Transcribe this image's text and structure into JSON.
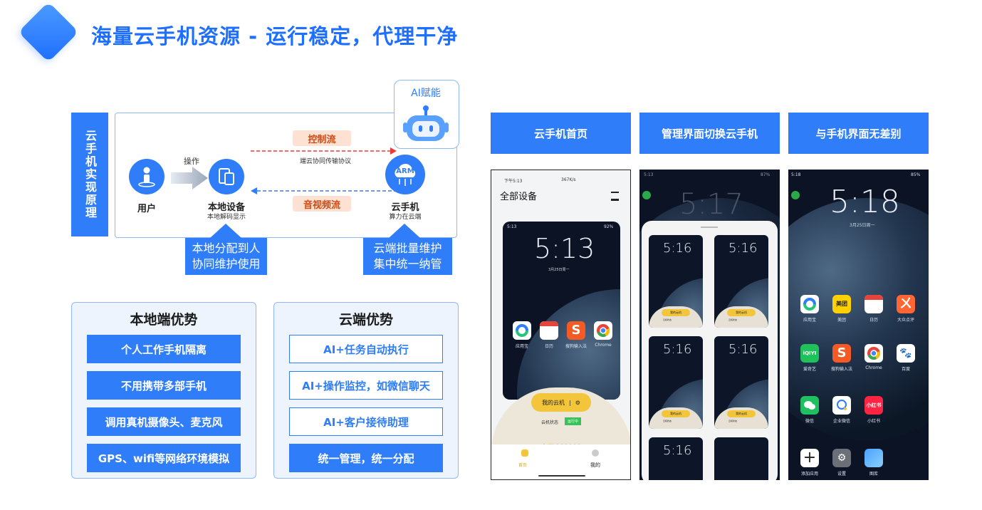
{
  "header": {
    "title": "海量云手机资源 - 运行稳定，代理干净"
  },
  "principle": {
    "side_label": "云手机实现原理",
    "user_label": "用户",
    "operate_label": "操作",
    "local_device_label": "本地设备",
    "local_device_sub": "本地解码显示",
    "control_flow": "控制流",
    "protocol_label": "端云协同传输协议",
    "av_flow": "音视频流",
    "cloud_phone_label": "云手机",
    "cloud_phone_sub": "算力在云端",
    "arm_label": "ARM",
    "ai_label": "AI赋能",
    "callout_left_1": "本地分配到人",
    "callout_left_2": "协同维护使用",
    "callout_right_1": "云端批量维护",
    "callout_right_2": "集中统一纳管"
  },
  "local_adv": {
    "title": "本地端优势",
    "items": [
      "个人工作手机隔离",
      "不用携带多部手机",
      "调用真机摄像头、麦克风",
      "GPS、wifi等网络环境模拟"
    ]
  },
  "cloud_adv": {
    "title": "云端优势",
    "items": [
      "AI+任务自动执行",
      "AI+操作监控，如微信聊天",
      "AI+客户接待助理",
      "统一管理，统一分配"
    ]
  },
  "screens": {
    "headers": [
      "云手机首页",
      "管理界面切换云手机",
      "与手机界面无差别"
    ],
    "s1": {
      "status_time": "下午5:13",
      "status_right": "367K/s",
      "title": "全部设备",
      "inner_status": "5:13",
      "inner_battery": "92%",
      "clock": "5:13",
      "date": "3月25日周一",
      "apps": [
        "应用宝",
        "日历",
        "搜狗输入法",
        "Chrome"
      ],
      "my_cloud": "我的云机",
      "cloud_status_label": "云机状态",
      "cloud_status_value": "运行中",
      "tab_home": "首页",
      "tab_mine": "我的"
    },
    "s2": {
      "status_time": "5:13",
      "battery": "87%",
      "bg_clock": "5:17",
      "mini_clock": "5:16",
      "my_cloud": "我的云机",
      "status_label": "云机状态",
      "status_value": "运行中"
    },
    "s3": {
      "status_time": "5:18",
      "battery": "85%",
      "clock": "5:18",
      "date": "3月25日周一",
      "apps": [
        "应用宝",
        "美团",
        "日历",
        "大众点评",
        "爱奇艺",
        "搜狗输入法",
        "Chrome",
        "百度",
        "微信",
        "企业微信",
        "小红书",
        "",
        "添加应用",
        "设置",
        "图库"
      ],
      "meituan": "美团",
      "iqiyi": "iQIYI",
      "xhs": "小红书"
    }
  }
}
